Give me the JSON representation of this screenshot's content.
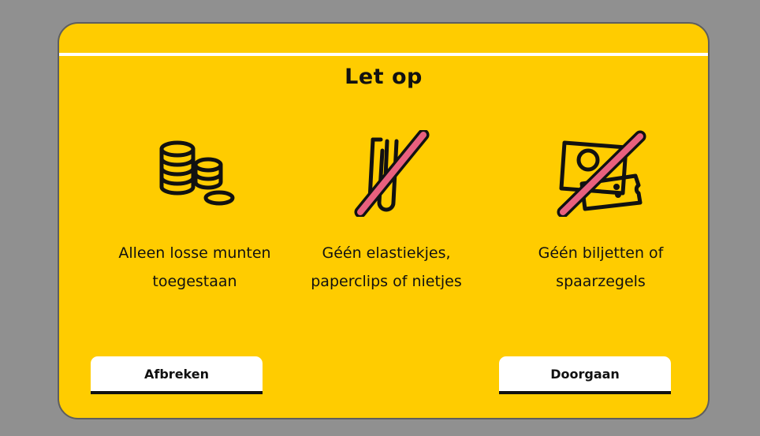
{
  "dialog": {
    "title": "Let op",
    "items": [
      {
        "icon": "coins-icon",
        "line1": "Alleen losse munten",
        "line2": "toegestaan"
      },
      {
        "icon": "no-paperclip-icon",
        "line1": "Géén elastiekjes,",
        "line2": "paperclips of nietjes"
      },
      {
        "icon": "no-banknote-icon",
        "line1": "Géén biljetten of",
        "line2": "spaarzegels"
      }
    ],
    "buttons": {
      "cancel": "Afbreken",
      "continue": "Doorgaan"
    }
  },
  "colors": {
    "background": "#909090",
    "panel": "#ffcc00",
    "strike": "#e8607e",
    "ink": "#111111"
  }
}
